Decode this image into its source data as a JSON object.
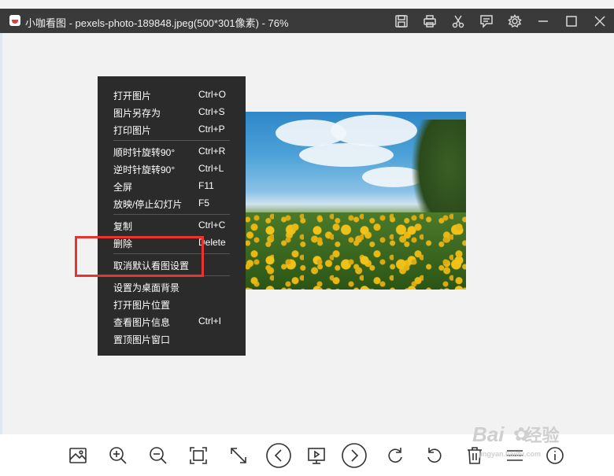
{
  "window": {
    "title": "小咖看图 - pexels-photo-189848.jpeg(500*301像素) - 76%"
  },
  "titlebar_icons": [
    "save-icon",
    "print-icon",
    "scissors-icon",
    "comment-icon",
    "gear-icon",
    "minimize-icon",
    "maximize-icon",
    "close-icon"
  ],
  "context_menu": {
    "items": [
      {
        "label": "打开图片",
        "shortcut": "Ctrl+O"
      },
      {
        "label": "图片另存为",
        "shortcut": "Ctrl+S"
      },
      {
        "label": "打印图片",
        "shortcut": "Ctrl+P"
      },
      {
        "label": "顺时针旋转90°",
        "shortcut": "Ctrl+R"
      },
      {
        "label": "逆时针旋转90°",
        "shortcut": "Ctrl+L"
      },
      {
        "label": "全屏",
        "shortcut": "F11"
      },
      {
        "label": "放映/停止幻灯片",
        "shortcut": "F5"
      },
      {
        "label": "复制",
        "shortcut": "Ctrl+C"
      },
      {
        "label": "删除",
        "shortcut": "Delete"
      },
      {
        "label": "取消默认看图设置",
        "shortcut": ""
      },
      {
        "label": "设置为桌面背景",
        "shortcut": ""
      },
      {
        "label": "打开图片位置",
        "shortcut": ""
      },
      {
        "label": "查看图片信息",
        "shortcut": "Ctrl+I"
      },
      {
        "label": "置顶图片窗口",
        "shortcut": ""
      }
    ]
  },
  "toolbar_icons": [
    "image-icon",
    "zoom-in-icon",
    "zoom-out-icon",
    "fit-screen-icon",
    "actual-size-icon",
    "previous-icon",
    "slideshow-icon",
    "next-icon",
    "rotate-clockwise-icon",
    "rotate-counterclockwise-icon",
    "delete-icon",
    "menu-icon",
    "info-icon"
  ],
  "watermark": {
    "brand": "Bai",
    "brand2": "经验",
    "sub": "jingyan.baidu.com"
  },
  "colors": {
    "titlebar": "#3a3a3a",
    "menu_bg": "#2b2b2b",
    "highlight": "#e8332f",
    "canvas": "#f2f2f2"
  }
}
